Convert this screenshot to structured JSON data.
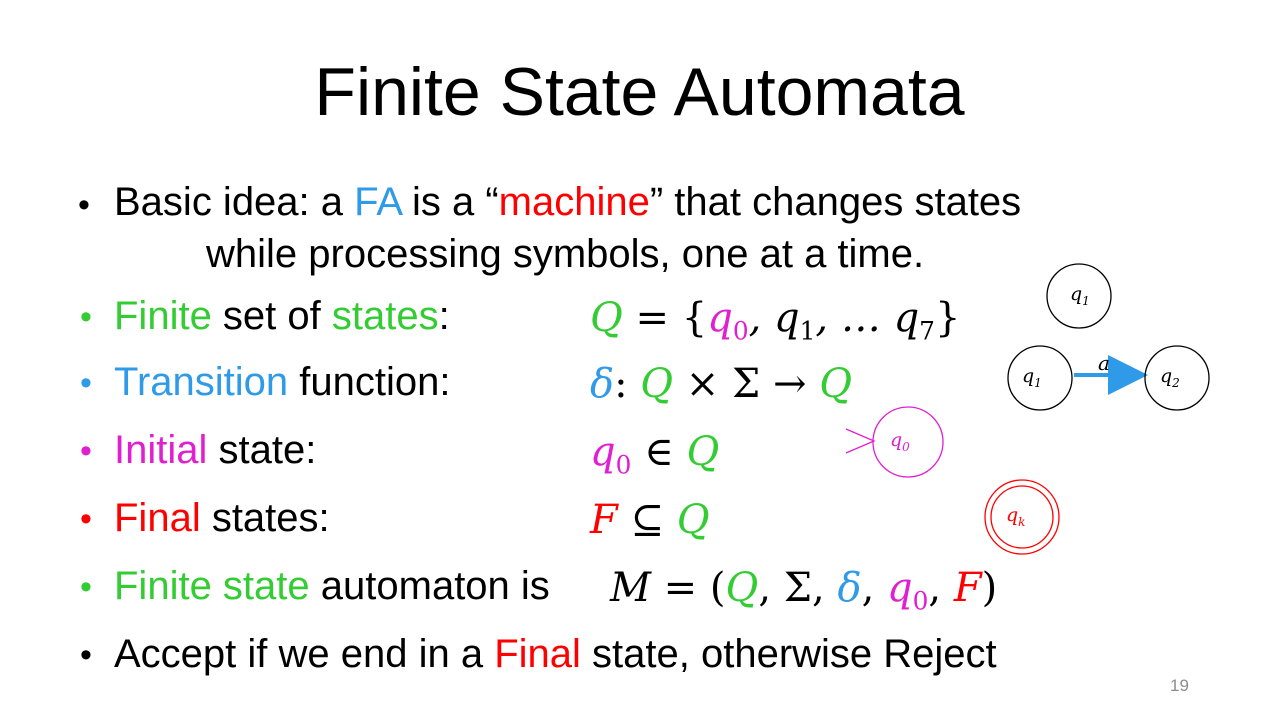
{
  "slide": {
    "title": "Finite State Automata",
    "page_number": "19"
  },
  "bullets": {
    "b1": {
      "t1": "Basic idea: a ",
      "fa": "FA",
      "t2": " is a “",
      "machine": "machine",
      "t3": "” that changes states",
      "line2": "while processing symbols, one at a time."
    },
    "b2": {
      "finite": "Finite",
      "t1": " set of ",
      "states": "states",
      "t2": ":"
    },
    "b3": {
      "transition": "Transition",
      "t1": " function:"
    },
    "b4": {
      "initial": "Initial",
      "t1": " state:"
    },
    "b5": {
      "final": "Final",
      "t1": " states:"
    },
    "b6": {
      "fs": "Finite state",
      "t1": " automaton is "
    },
    "b7": {
      "t1": "Accept if we end in a ",
      "final": "Final",
      "t2": " state, otherwise Reject"
    }
  },
  "math": {
    "states_set": {
      "Q": "Q",
      "eq": " = {",
      "q0": "q",
      "q0_sub": "0",
      "rest1": ", q",
      "q1_sub": "1",
      "rest2": ", … q",
      "q7_sub": "7",
      "close": "}"
    },
    "delta": {
      "d": "δ",
      "colon": ": ",
      "Q1": "Q",
      "times": " × Σ → ",
      "Q2": "Q"
    },
    "initial": {
      "q": "q",
      "sub": "0",
      "in": " ∈ ",
      "Q": "Q"
    },
    "final": {
      "F": "F",
      "sub": " ⊆ ",
      "Q": "Q"
    },
    "tuple": {
      "M": "M",
      "eq": " = (",
      "Q": "Q",
      "c1": ", Σ, ",
      "d": "δ",
      "c2": ", ",
      "q": "q",
      "sub": "0",
      "c3": ", ",
      "F": "F",
      "close": ")"
    }
  },
  "diagram": {
    "state_a": {
      "label": "q",
      "sub": "1"
    },
    "state_b": {
      "label": "q",
      "sub": "1"
    },
    "state_c": {
      "label": "q",
      "sub": "2"
    },
    "edge_label": "a",
    "initial_state": {
      "label": "q",
      "sub": "0"
    },
    "final_state": {
      "label": "q",
      "sub": "k"
    }
  },
  "colors": {
    "green": "#33cc33",
    "blue": "#2f9ae8",
    "magenta": "#e020d0",
    "red": "#ff0000"
  }
}
